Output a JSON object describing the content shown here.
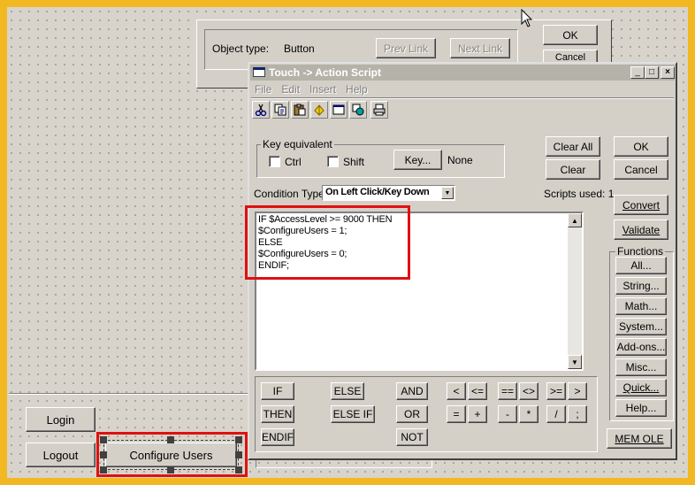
{
  "canvas": {
    "buttons": {
      "login": "Login",
      "logout": "Logout",
      "configure_users": "Configure Users"
    }
  },
  "back_dialog": {
    "object_type_label": "Object type:",
    "object_type_value": "Button",
    "prev_link": "Prev Link",
    "next_link": "Next Link",
    "ok": "OK",
    "cancel": "Cancel"
  },
  "dialog": {
    "title": "Touch -> Action Script",
    "menu": [
      "File",
      "Edit",
      "Insert",
      "Help"
    ],
    "toolbar_icons": [
      "cut-icon",
      "copy-icon",
      "paste-icon",
      "find-icon",
      "window-icon",
      "replace-icon",
      "print-icon"
    ],
    "key_equivalent": {
      "legend": "Key equivalent",
      "ctrl": "Ctrl",
      "shift": "Shift",
      "key_button": "Key...",
      "key_value": "None"
    },
    "buttons": {
      "clear_all": "Clear All",
      "clear": "Clear",
      "ok": "OK",
      "cancel": "Cancel",
      "convert": "Convert",
      "validate": "Validate",
      "mem_ole": "MEM OLE"
    },
    "condition_type_label": "Condition Type:",
    "condition_type_value": "On Left Click/Key Down",
    "scripts_used": "Scripts used: 1",
    "script_lines": [
      "IF $AccessLevel >= 9000 THEN",
      "$ConfigureUsers = 1;",
      "ELSE",
      "$ConfigureUsers = 0;",
      "ENDIF;"
    ],
    "functions": {
      "legend": "Functions",
      "items": [
        "All...",
        "String...",
        "Math...",
        "System...",
        "Add-ons...",
        "Misc...",
        "Quick...",
        "Help..."
      ]
    },
    "keywords": [
      "IF",
      "ELSE",
      "AND",
      "THEN",
      "ELSE IF",
      "OR",
      "ENDIF",
      "NOT"
    ],
    "operators": [
      "<",
      "<=",
      "==",
      "<>",
      ">=",
      ">",
      "=",
      "+",
      "-",
      "*",
      "/",
      ";"
    ]
  }
}
